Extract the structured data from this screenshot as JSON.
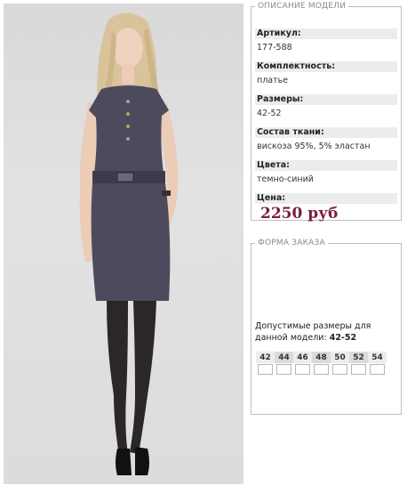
{
  "description": {
    "legend": "ОПИСАНИЕ МОДЕЛИ",
    "fields": [
      {
        "label": "Артикул:",
        "value": "177-588"
      },
      {
        "label": "Комплектность:",
        "value": "платье"
      },
      {
        "label": "Размеры:",
        "value": "42-52"
      },
      {
        "label": "Состав ткани:",
        "value": "вискоза 95%, 5% эластан"
      },
      {
        "label": "Цвета:",
        "value": "темно-синий"
      }
    ],
    "price_label": "Цена:",
    "price": "2250 руб"
  },
  "order": {
    "legend": "ФОРМА ЗАКАЗА",
    "note": "Допустимые размеры для данной модели:",
    "range": "42-52",
    "sizes": [
      "42",
      "44",
      "46",
      "48",
      "50",
      "52",
      "54"
    ]
  },
  "colors": {
    "price": "#7b1f3c",
    "dress": "#4e4a5e",
    "background": "#dcdcdc"
  }
}
